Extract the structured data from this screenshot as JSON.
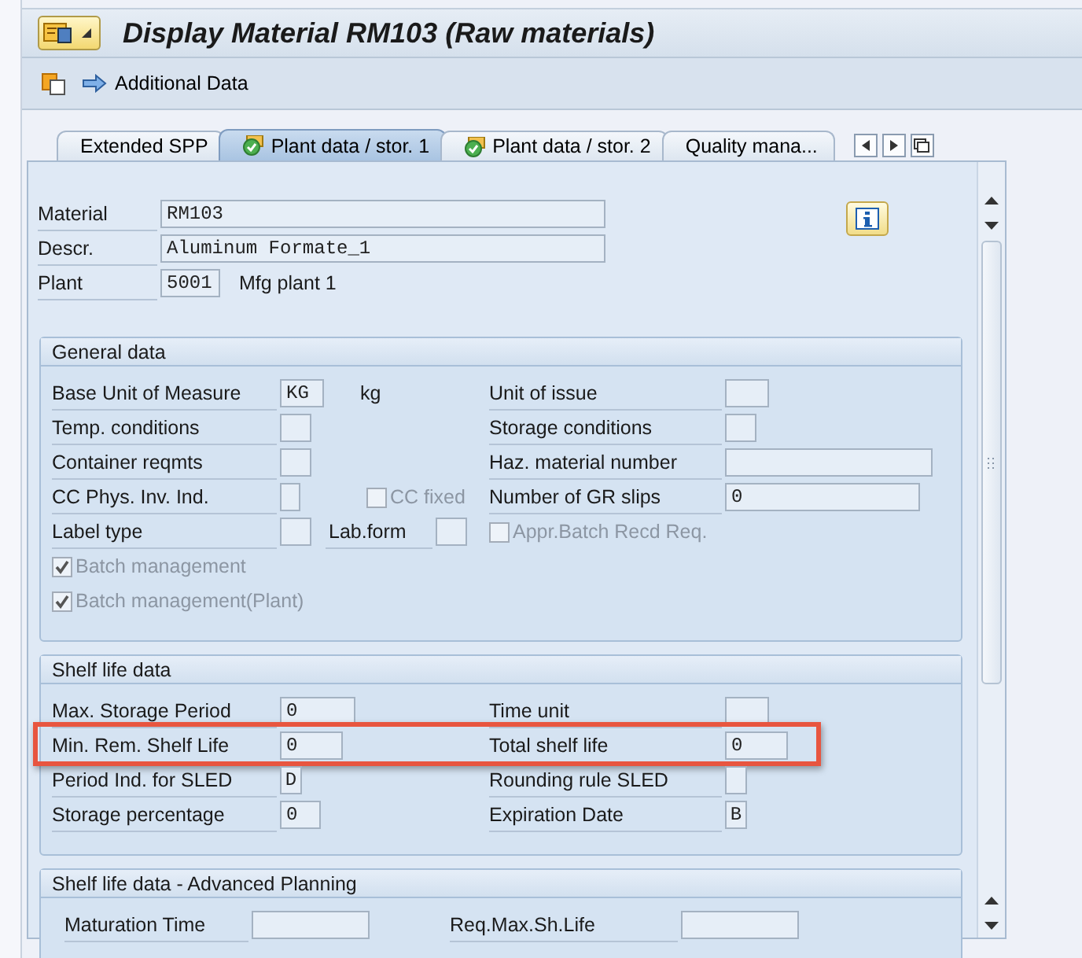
{
  "window": {
    "title": "Display Material RM103 (Raw materials)"
  },
  "toolbar": {
    "action": "Additional Data"
  },
  "tabs": [
    {
      "label": "Extended SPP",
      "selected": false,
      "complete": false
    },
    {
      "label": "Plant data / stor. 1",
      "selected": true,
      "complete": true
    },
    {
      "label": "Plant data / stor. 2",
      "selected": false,
      "complete": true
    },
    {
      "label": "Quality mana...",
      "selected": false,
      "complete": false
    }
  ],
  "header": [
    {
      "label": "Material",
      "value": "RM103"
    },
    {
      "label": "Descr.",
      "value": "Aluminum Formate_1"
    },
    {
      "label": "Plant",
      "value": "5001",
      "note": "Mfg plant 1"
    }
  ],
  "groups": [
    {
      "title": "General data",
      "rows": [
        {
          "left": {
            "label": "Base Unit of Measure",
            "value": "KG"
          },
          "middle": {
            "kind": "text",
            "text": "kg"
          },
          "right": {
            "label": "Unit of issue"
          }
        },
        {
          "left": {
            "label": "Temp. conditions"
          },
          "right": {
            "label": "Storage conditions"
          }
        },
        {
          "left": {
            "label": "Container reqmts"
          },
          "right": {
            "label": "Haz. material number"
          }
        },
        {
          "left": {
            "label": "CC Phys. Inv. Ind."
          },
          "middle": {
            "kind": "checkbox",
            "label": "CC fixed",
            "checked": false,
            "disabled": true
          },
          "right": {
            "label": "Number of GR slips",
            "value": "0"
          }
        },
        {
          "left": {
            "label": "Label type"
          },
          "middle": {
            "kind": "field",
            "label": "Lab.form"
          },
          "right": {
            "kind": "checkbox",
            "label": "Appr.Batch Recd Req.",
            "checked": false,
            "disabled": true
          }
        },
        {
          "full": {
            "kind": "checkbox",
            "label": "Batch management",
            "checked": true,
            "disabled": true
          }
        },
        {
          "full": {
            "kind": "checkbox",
            "label": "Batch management(Plant)",
            "checked": true,
            "disabled": true
          }
        }
      ]
    },
    {
      "title": "Shelf life data",
      "rows": [
        {
          "left": {
            "label": "Max. Storage Period",
            "value": "0"
          },
          "right": {
            "label": "Time unit"
          }
        },
        {
          "left": {
            "label": "Min. Rem. Shelf Life",
            "value": "0"
          },
          "right": {
            "label": "Total shelf life",
            "value": "0"
          },
          "highlighted": true
        },
        {
          "left": {
            "label": "Period Ind. for SLED",
            "value": "D"
          },
          "right": {
            "label": "Rounding rule SLED"
          }
        },
        {
          "left": {
            "label": "Storage percentage",
            "value": "0"
          },
          "right": {
            "label": "Expiration Date",
            "value": "B"
          }
        }
      ]
    },
    {
      "title": "Shelf life data - Advanced Planning",
      "kind": "wide",
      "rows": [
        {
          "left": {
            "label": "Maturation Time"
          },
          "right": {
            "label": "Req.Max.Sh.Life"
          }
        }
      ]
    }
  ]
}
